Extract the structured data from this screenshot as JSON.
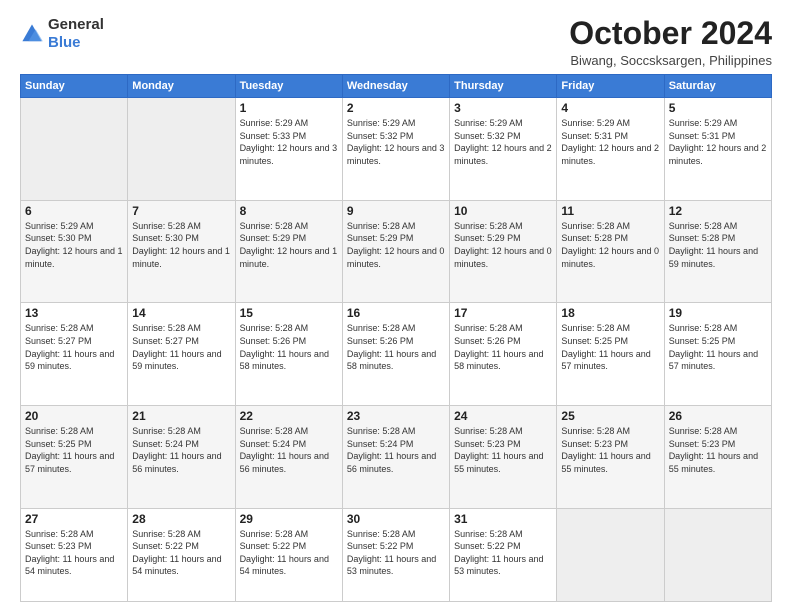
{
  "logo": {
    "general": "General",
    "blue": "Blue"
  },
  "title": "October 2024",
  "location": "Biwang, Soccsksargen, Philippines",
  "headers": [
    "Sunday",
    "Monday",
    "Tuesday",
    "Wednesday",
    "Thursday",
    "Friday",
    "Saturday"
  ],
  "weeks": [
    [
      {
        "day": "",
        "info": ""
      },
      {
        "day": "",
        "info": ""
      },
      {
        "day": "1",
        "info": "Sunrise: 5:29 AM\nSunset: 5:33 PM\nDaylight: 12 hours and 3 minutes."
      },
      {
        "day": "2",
        "info": "Sunrise: 5:29 AM\nSunset: 5:32 PM\nDaylight: 12 hours and 3 minutes."
      },
      {
        "day": "3",
        "info": "Sunrise: 5:29 AM\nSunset: 5:32 PM\nDaylight: 12 hours and 2 minutes."
      },
      {
        "day": "4",
        "info": "Sunrise: 5:29 AM\nSunset: 5:31 PM\nDaylight: 12 hours and 2 minutes."
      },
      {
        "day": "5",
        "info": "Sunrise: 5:29 AM\nSunset: 5:31 PM\nDaylight: 12 hours and 2 minutes."
      }
    ],
    [
      {
        "day": "6",
        "info": "Sunrise: 5:29 AM\nSunset: 5:30 PM\nDaylight: 12 hours and 1 minute."
      },
      {
        "day": "7",
        "info": "Sunrise: 5:28 AM\nSunset: 5:30 PM\nDaylight: 12 hours and 1 minute."
      },
      {
        "day": "8",
        "info": "Sunrise: 5:28 AM\nSunset: 5:29 PM\nDaylight: 12 hours and 1 minute."
      },
      {
        "day": "9",
        "info": "Sunrise: 5:28 AM\nSunset: 5:29 PM\nDaylight: 12 hours and 0 minutes."
      },
      {
        "day": "10",
        "info": "Sunrise: 5:28 AM\nSunset: 5:29 PM\nDaylight: 12 hours and 0 minutes."
      },
      {
        "day": "11",
        "info": "Sunrise: 5:28 AM\nSunset: 5:28 PM\nDaylight: 12 hours and 0 minutes."
      },
      {
        "day": "12",
        "info": "Sunrise: 5:28 AM\nSunset: 5:28 PM\nDaylight: 11 hours and 59 minutes."
      }
    ],
    [
      {
        "day": "13",
        "info": "Sunrise: 5:28 AM\nSunset: 5:27 PM\nDaylight: 11 hours and 59 minutes."
      },
      {
        "day": "14",
        "info": "Sunrise: 5:28 AM\nSunset: 5:27 PM\nDaylight: 11 hours and 59 minutes."
      },
      {
        "day": "15",
        "info": "Sunrise: 5:28 AM\nSunset: 5:26 PM\nDaylight: 11 hours and 58 minutes."
      },
      {
        "day": "16",
        "info": "Sunrise: 5:28 AM\nSunset: 5:26 PM\nDaylight: 11 hours and 58 minutes."
      },
      {
        "day": "17",
        "info": "Sunrise: 5:28 AM\nSunset: 5:26 PM\nDaylight: 11 hours and 58 minutes."
      },
      {
        "day": "18",
        "info": "Sunrise: 5:28 AM\nSunset: 5:25 PM\nDaylight: 11 hours and 57 minutes."
      },
      {
        "day": "19",
        "info": "Sunrise: 5:28 AM\nSunset: 5:25 PM\nDaylight: 11 hours and 57 minutes."
      }
    ],
    [
      {
        "day": "20",
        "info": "Sunrise: 5:28 AM\nSunset: 5:25 PM\nDaylight: 11 hours and 57 minutes."
      },
      {
        "day": "21",
        "info": "Sunrise: 5:28 AM\nSunset: 5:24 PM\nDaylight: 11 hours and 56 minutes."
      },
      {
        "day": "22",
        "info": "Sunrise: 5:28 AM\nSunset: 5:24 PM\nDaylight: 11 hours and 56 minutes."
      },
      {
        "day": "23",
        "info": "Sunrise: 5:28 AM\nSunset: 5:24 PM\nDaylight: 11 hours and 56 minutes."
      },
      {
        "day": "24",
        "info": "Sunrise: 5:28 AM\nSunset: 5:23 PM\nDaylight: 11 hours and 55 minutes."
      },
      {
        "day": "25",
        "info": "Sunrise: 5:28 AM\nSunset: 5:23 PM\nDaylight: 11 hours and 55 minutes."
      },
      {
        "day": "26",
        "info": "Sunrise: 5:28 AM\nSunset: 5:23 PM\nDaylight: 11 hours and 55 minutes."
      }
    ],
    [
      {
        "day": "27",
        "info": "Sunrise: 5:28 AM\nSunset: 5:23 PM\nDaylight: 11 hours and 54 minutes."
      },
      {
        "day": "28",
        "info": "Sunrise: 5:28 AM\nSunset: 5:22 PM\nDaylight: 11 hours and 54 minutes."
      },
      {
        "day": "29",
        "info": "Sunrise: 5:28 AM\nSunset: 5:22 PM\nDaylight: 11 hours and 54 minutes."
      },
      {
        "day": "30",
        "info": "Sunrise: 5:28 AM\nSunset: 5:22 PM\nDaylight: 11 hours and 53 minutes."
      },
      {
        "day": "31",
        "info": "Sunrise: 5:28 AM\nSunset: 5:22 PM\nDaylight: 11 hours and 53 minutes."
      },
      {
        "day": "",
        "info": ""
      },
      {
        "day": "",
        "info": ""
      }
    ]
  ]
}
